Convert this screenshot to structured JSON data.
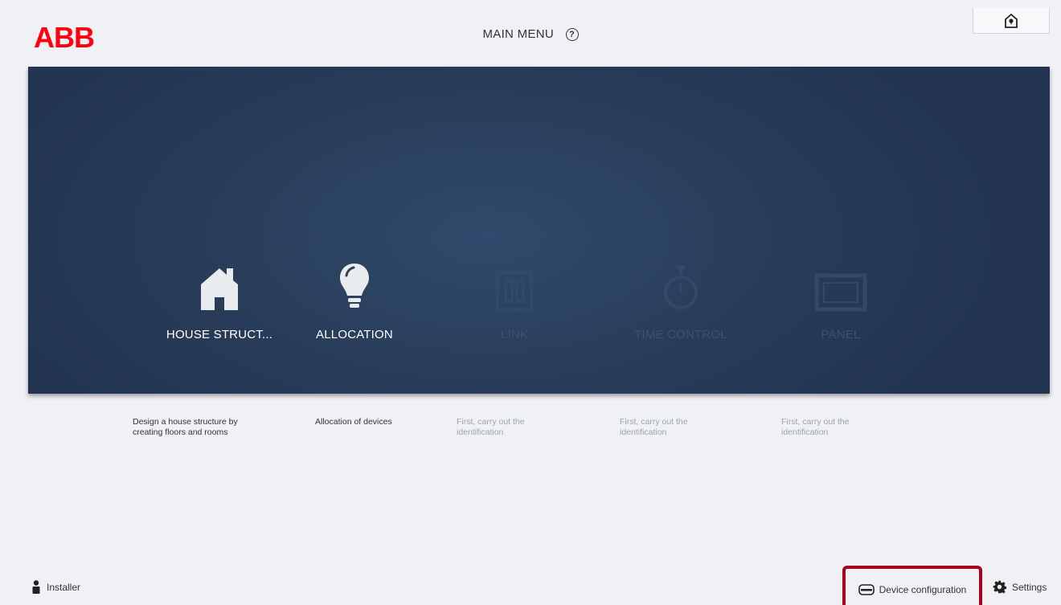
{
  "header": {
    "logo_text": "ABB",
    "title": "MAIN MENU",
    "help_icon": "?"
  },
  "tiles": [
    {
      "label": "HOUSE STRUCT...",
      "icon": "house-icon",
      "enabled": true,
      "description": [
        "Design a house structure by",
        "creating floors and rooms"
      ]
    },
    {
      "label": "ALLOCATION",
      "icon": "lightbulb-icon",
      "enabled": true,
      "description": [
        "Allocation of devices",
        ""
      ]
    },
    {
      "label": "LINK",
      "icon": "link-icon",
      "enabled": false,
      "description": [
        "First, carry out the",
        "identification"
      ]
    },
    {
      "label": "TIME CONTROL",
      "icon": "timer-icon",
      "enabled": false,
      "description": [
        "First, carry out the",
        "identification"
      ]
    },
    {
      "label": "PANEL",
      "icon": "panel-icon",
      "enabled": false,
      "description": [
        "First, carry out the",
        "identification"
      ]
    }
  ],
  "footer": {
    "installer_label": "Installer",
    "device_config_label": "Device configuration",
    "settings_label": "Settings"
  },
  "colors": {
    "brand": "#ff000f",
    "panel": "#2a3f5c",
    "highlight": "#a8001e"
  }
}
